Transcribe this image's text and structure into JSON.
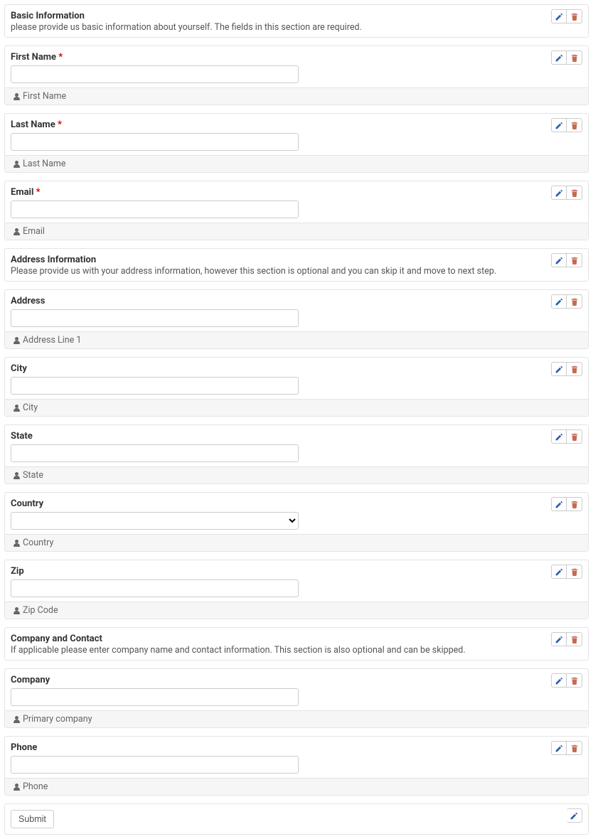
{
  "sections": [
    {
      "type": "header",
      "title": "Basic Information",
      "desc": "please provide us basic information about yourself. The fields in this section are required."
    },
    {
      "type": "field",
      "label": "First Name",
      "required": true,
      "kind": "text",
      "hint": "First Name"
    },
    {
      "type": "field",
      "label": "Last Name",
      "required": true,
      "kind": "text",
      "hint": "Last Name"
    },
    {
      "type": "field",
      "label": "Email",
      "required": true,
      "kind": "text",
      "hint": "Email"
    },
    {
      "type": "header",
      "title": "Address Information",
      "desc": "Please provide us with your address information, however this section is optional and you can skip it and move to next step."
    },
    {
      "type": "field",
      "label": "Address",
      "required": false,
      "kind": "text",
      "hint": "Address Line 1"
    },
    {
      "type": "field",
      "label": "City",
      "required": false,
      "kind": "text",
      "hint": "City"
    },
    {
      "type": "field",
      "label": "State",
      "required": false,
      "kind": "text",
      "hint": "State"
    },
    {
      "type": "field",
      "label": "Country",
      "required": false,
      "kind": "select",
      "hint": "Country"
    },
    {
      "type": "field",
      "label": "Zip",
      "required": false,
      "kind": "text",
      "hint": "Zip Code"
    },
    {
      "type": "header",
      "title": "Company and Contact",
      "desc": "If applicable please enter company name and contact information. This section is also optional and can be skipped."
    },
    {
      "type": "field",
      "label": "Company",
      "required": false,
      "kind": "text",
      "hint": "Primary company"
    },
    {
      "type": "field",
      "label": "Phone",
      "required": false,
      "kind": "text",
      "hint": "Phone"
    }
  ],
  "submit_label": "Submit",
  "required_marker": "*"
}
